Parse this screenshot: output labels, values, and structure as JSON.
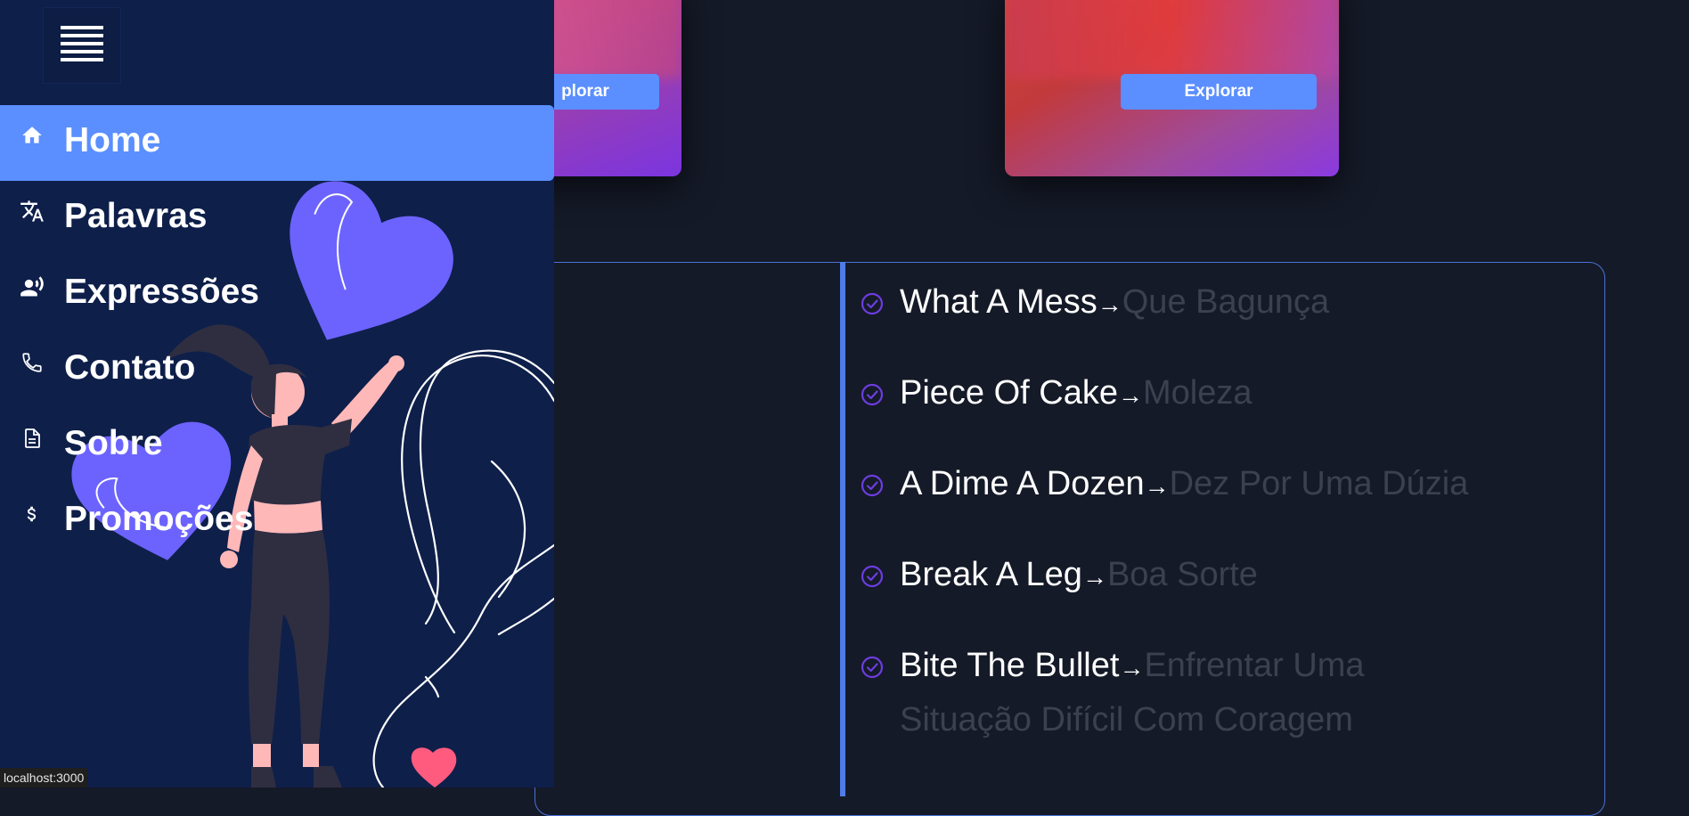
{
  "cards": [
    {
      "button_label": "Explorar",
      "visible_label": "plorar"
    },
    {
      "button_label": "Explorar"
    }
  ],
  "phrases": [
    {
      "en": "What A Mess",
      "pt": "Que Bagunça"
    },
    {
      "en": "Piece Of Cake",
      "pt": "Moleza"
    },
    {
      "en": "A Dime A Dozen",
      "pt": "Dez Por Uma Dúzia"
    },
    {
      "en": "Break A Leg",
      "pt": "Boa Sorte"
    },
    {
      "en": "Bite The Bullet",
      "pt": "Enfrentar Uma Situação Difícil Com Coragem"
    }
  ],
  "arrow": "→",
  "sidebar": {
    "menu_icon": "hamburger-icon",
    "items": [
      {
        "label": "Home",
        "icon": "home-icon",
        "active": true
      },
      {
        "label": "Palavras",
        "icon": "translate-icon",
        "active": false
      },
      {
        "label": "Expressões",
        "icon": "voice-icon",
        "active": false
      },
      {
        "label": "Contato",
        "icon": "phone-icon",
        "active": false
      },
      {
        "label": "Sobre",
        "icon": "document-icon",
        "active": false
      },
      {
        "label": "Promoções",
        "icon": "dollar-icon",
        "active": false
      }
    ]
  },
  "status_url": "localhost:3000",
  "colors": {
    "page_bg": "#151a28",
    "sidebar_bg": "#0e1f4a",
    "accent": "#5b8fff",
    "check": "#6c3de0",
    "heart": "#6c63ff",
    "heart_small": "#ff5b7f"
  }
}
